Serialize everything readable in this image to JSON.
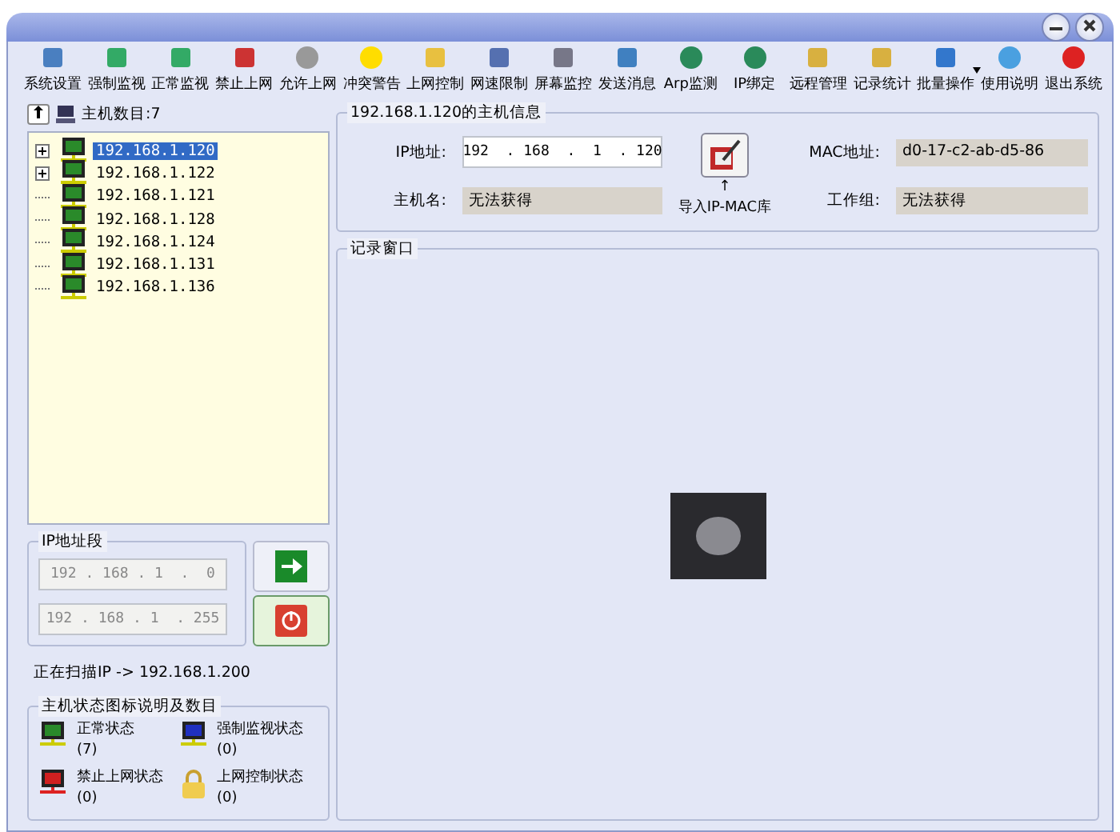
{
  "toolbar": [
    {
      "label": "系统设置"
    },
    {
      "label": "强制监视"
    },
    {
      "label": "正常监视"
    },
    {
      "label": "禁止上网"
    },
    {
      "label": "允许上网"
    },
    {
      "label": "冲突警告"
    },
    {
      "label": "上网控制"
    },
    {
      "label": "网速限制"
    },
    {
      "label": "屏幕监控"
    },
    {
      "label": "发送消息"
    },
    {
      "label": "Arp监测"
    },
    {
      "label": "IP绑定"
    },
    {
      "label": "远程管理"
    },
    {
      "label": "记录统计"
    },
    {
      "label": "批量操作",
      "dropdown": true
    },
    {
      "label": "使用说明"
    },
    {
      "label": "退出系统"
    }
  ],
  "hosts": {
    "count_label": "主机数目:7",
    "items": [
      {
        "ip": "192.168.1.120",
        "selected": true,
        "expandable": true
      },
      {
        "ip": "192.168.1.122",
        "selected": false,
        "expandable": true
      },
      {
        "ip": "192.168.1.121",
        "selected": false,
        "expandable": false
      },
      {
        "ip": "192.168.1.128",
        "selected": false,
        "expandable": false
      },
      {
        "ip": "192.168.1.124",
        "selected": false,
        "expandable": false
      },
      {
        "ip": "192.168.1.131",
        "selected": false,
        "expandable": false
      },
      {
        "ip": "192.168.1.136",
        "selected": false,
        "expandable": false
      }
    ]
  },
  "ip_range": {
    "title": "IP地址段",
    "start": "192 . 168 . 1  .  0",
    "end": "192 . 168 . 1  . 255"
  },
  "scan_status": "正在扫描IP -> 192.168.1.200",
  "legend": {
    "title": "主机状态图标说明及数目",
    "items": [
      {
        "kind": "normal",
        "label": "正常状态",
        "count": "(7)"
      },
      {
        "kind": "monitored",
        "label": "强制监视状态",
        "count": "(0)"
      },
      {
        "kind": "blocked",
        "label": "禁止上网状态",
        "count": "(0)"
      },
      {
        "kind": "controlled",
        "label": "上网控制状态",
        "count": "(0)"
      }
    ]
  },
  "host_info": {
    "title": "192.168.1.120的主机信息",
    "ip_label": "IP地址:",
    "ip": "192  . 168  .  1  . 120",
    "host_label": "主机名:",
    "host": "无法获得",
    "import_arrow": "↑",
    "import_label": "导入IP-MAC库",
    "mac_label": "MAC地址:",
    "mac": "d0-17-c2-ab-d5-86",
    "group_label": "工作组:",
    "group": "无法获得"
  },
  "log": {
    "title": "记录窗口"
  }
}
